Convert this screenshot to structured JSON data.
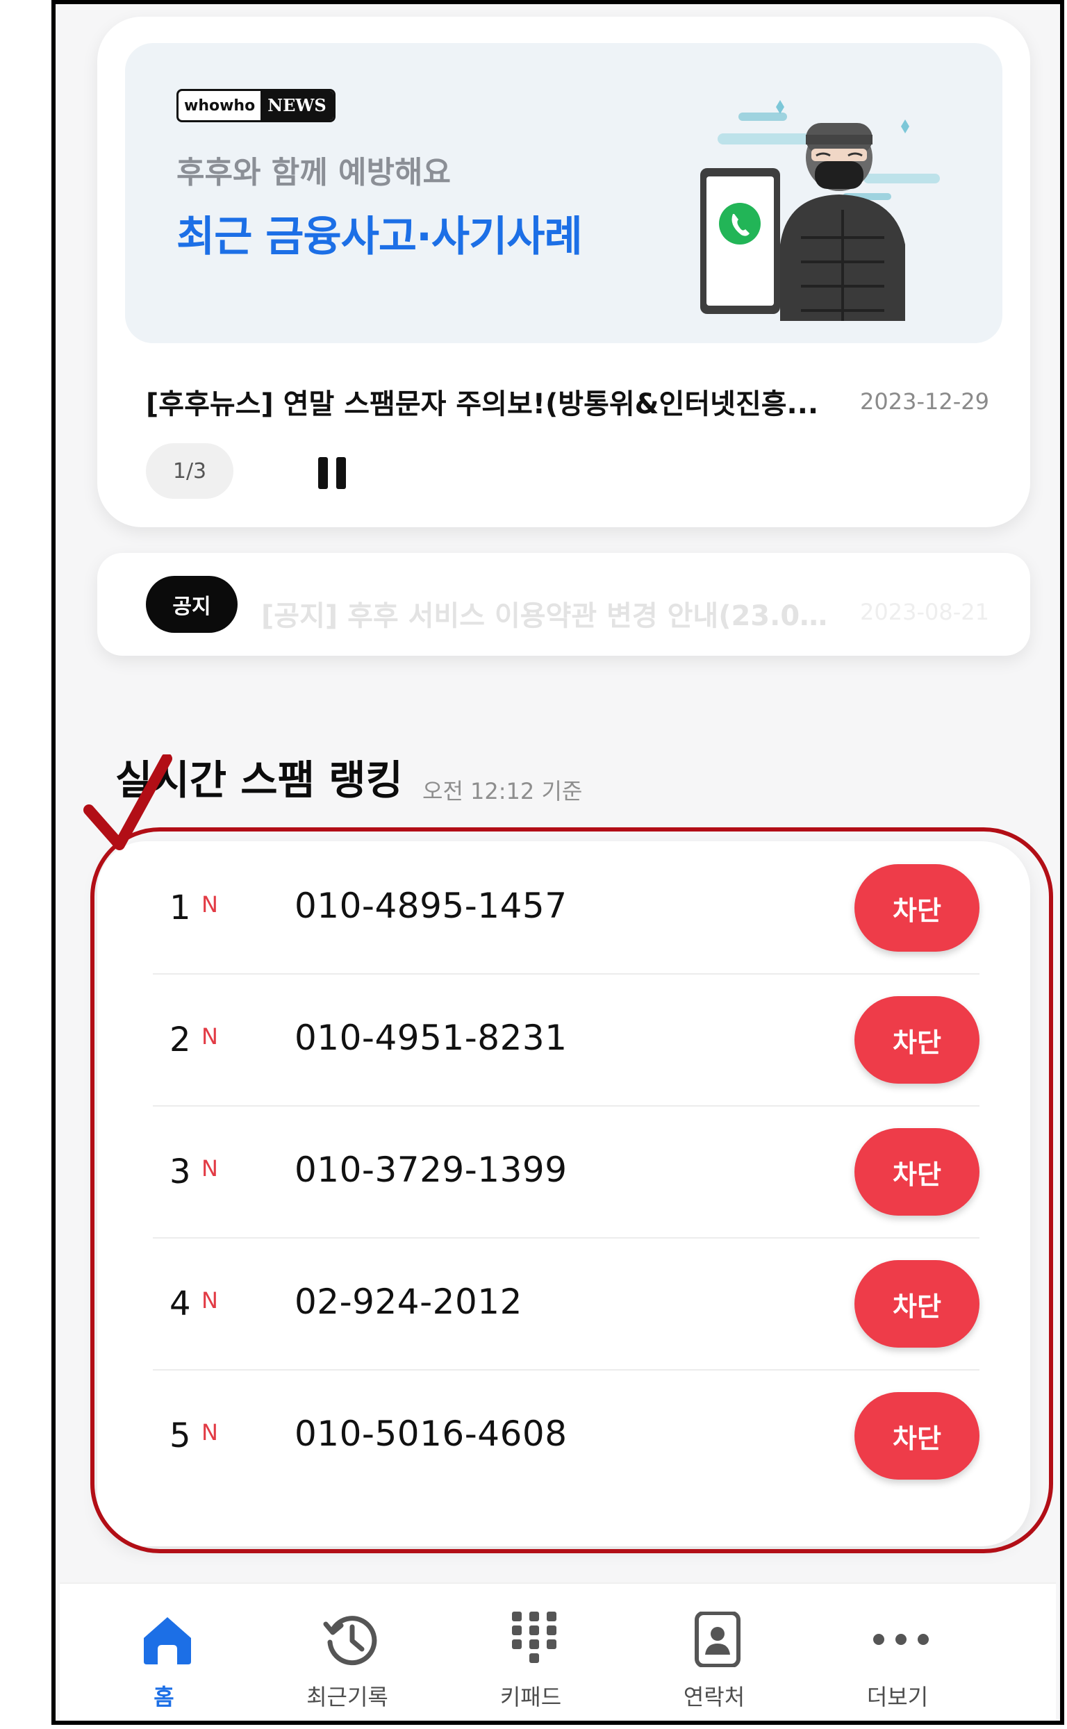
{
  "news": {
    "logo_small": "whowho",
    "logo_big": "NEWS",
    "banner_subtitle": "후후와 함께 예방해요",
    "banner_title": "최근 금융사고·사기사례",
    "headline": "[후후뉴스] 연말 스팸문자 주의보!(방통위&인터넷진흥...",
    "date": "2023-12-29",
    "pager": "1/3"
  },
  "notice": {
    "badge": "공지",
    "text": "[공지] 후후 서비스 이용약관 변경 안내(23.0...",
    "date": "2023-08-21"
  },
  "ranking": {
    "title": "실시간 스팸 랭킹",
    "updated": "오전 12:12 기준",
    "new_marker": "N",
    "block_label": "차단",
    "rows": [
      {
        "rank": "1",
        "phone": "010-4895-1457"
      },
      {
        "rank": "2",
        "phone": "010-4951-8231"
      },
      {
        "rank": "3",
        "phone": "010-3729-1399"
      },
      {
        "rank": "4",
        "phone": "02-924-2012"
      },
      {
        "rank": "5",
        "phone": "010-5016-4608"
      }
    ]
  },
  "tabs": [
    {
      "label": "홈",
      "icon": "home-icon",
      "active": true
    },
    {
      "label": "최근기록",
      "icon": "history-icon"
    },
    {
      "label": "키패드",
      "icon": "keypad-icon"
    },
    {
      "label": "연락처",
      "icon": "contacts-icon"
    },
    {
      "label": "더보기",
      "icon": "more-icon"
    }
  ],
  "colors": {
    "accent_blue": "#1c6fe6",
    "block_red": "#ee3c49",
    "annotation_red": "#b20e16"
  }
}
